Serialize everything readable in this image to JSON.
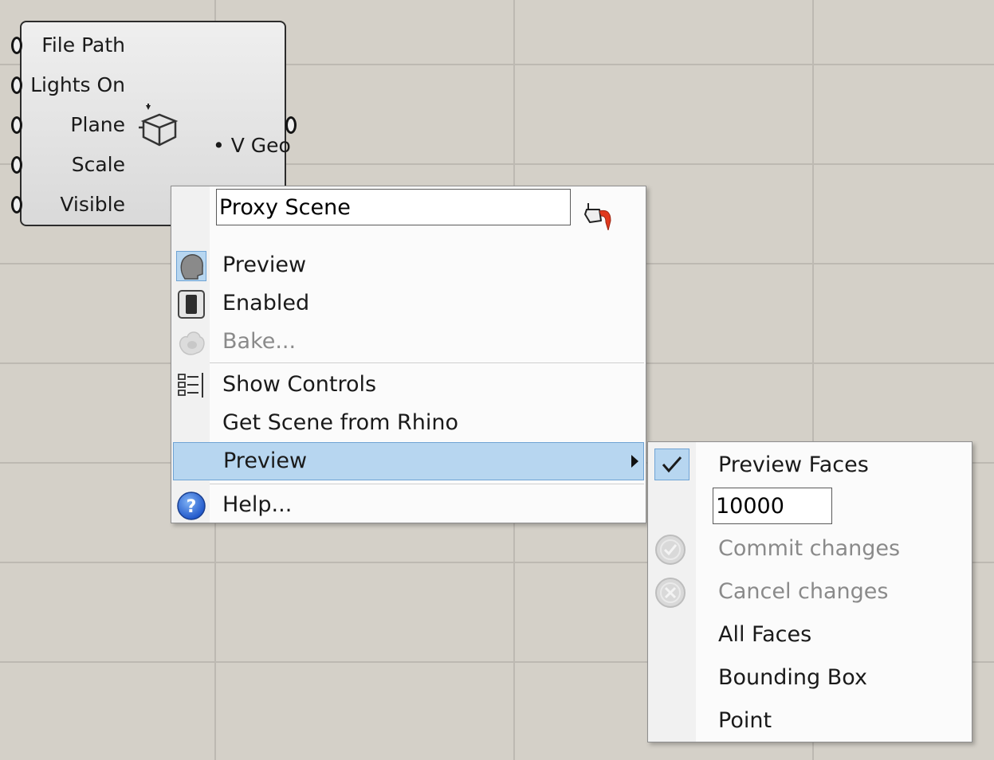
{
  "component": {
    "inputs": [
      "File Path",
      "Lights On",
      "Plane",
      "Scale",
      "Visible"
    ],
    "output": "• V Geo",
    "icon": "box-with-arrow-icon"
  },
  "menu": {
    "name_value": "Proxy Scene",
    "name_icon": "paint-bucket-icon",
    "items": [
      {
        "label": "Preview",
        "icon": "preview-head-icon"
      },
      {
        "label": "Enabled",
        "icon": "enabled-switch-icon"
      },
      {
        "label": "Bake...",
        "icon": "bake-egg-icon"
      },
      {
        "label": "Show Controls",
        "icon": "list-controls-icon"
      },
      {
        "label": "Get Scene from Rhino",
        "icon": ""
      },
      {
        "label": "Preview",
        "icon": ""
      },
      {
        "label": "Help...",
        "icon": "help-question-icon"
      }
    ]
  },
  "submenu": {
    "preview_faces": "Preview Faces",
    "faces_value": "10000",
    "commit": "Commit changes",
    "cancel": "Cancel changes",
    "all_faces": "All Faces",
    "bounding_box": "Bounding Box",
    "point": "Point"
  }
}
